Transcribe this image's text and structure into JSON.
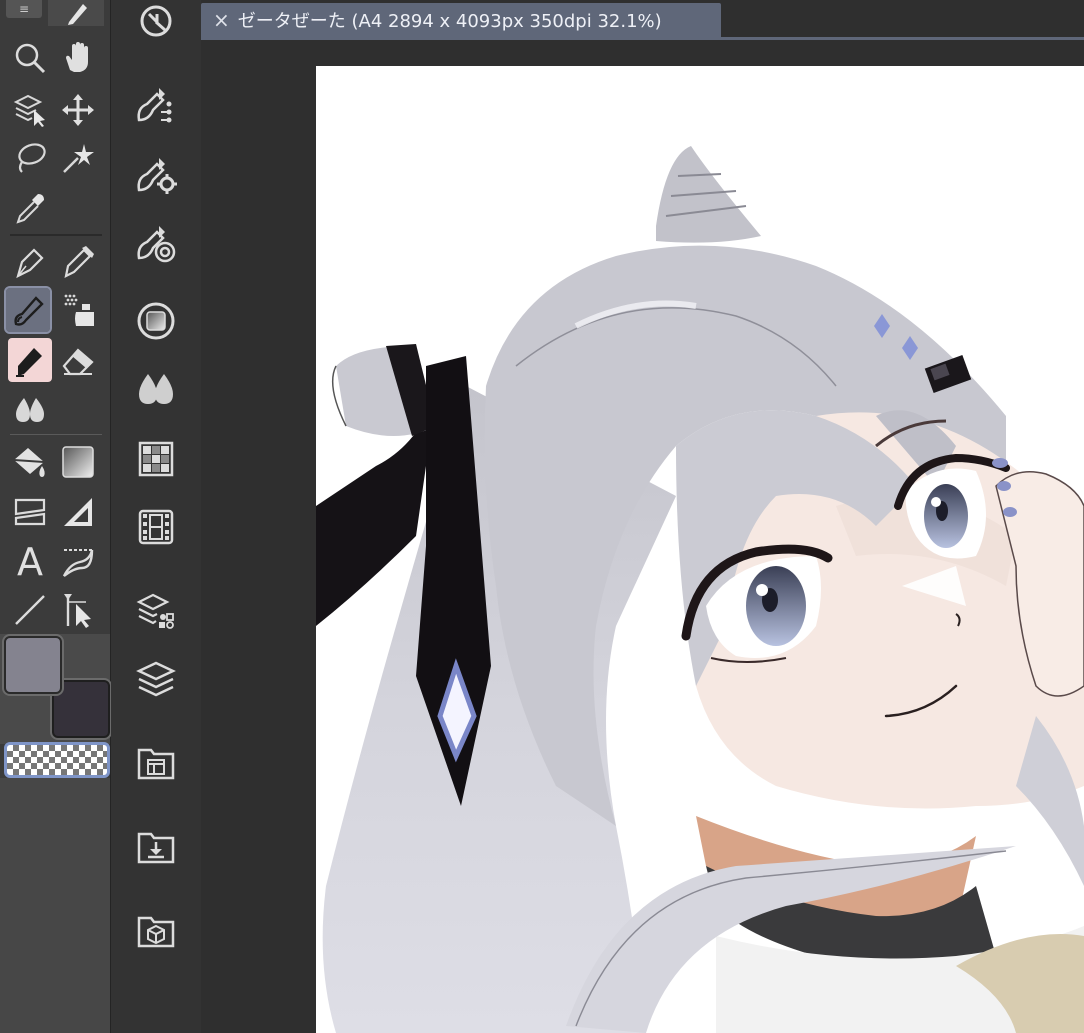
{
  "document_tab": {
    "title": "ゼータぜーた (A4 2894 x 4093px 350dpi 32.1%)",
    "close_icon": "×"
  },
  "tool_palette": {
    "menu_icon": "≡",
    "tools": [
      {
        "name": "zoom",
        "icon": "magnifier-icon"
      },
      {
        "name": "hand",
        "icon": "hand-icon"
      },
      {
        "name": "object-select",
        "icon": "layer-select-icon"
      },
      {
        "name": "move",
        "icon": "move-arrows-icon"
      },
      {
        "name": "lasso",
        "icon": "lasso-icon"
      },
      {
        "name": "auto-select",
        "icon": "magic-wand-icon"
      },
      {
        "name": "eyedropper",
        "icon": "eyedropper-icon"
      },
      {
        "name": "pen",
        "icon": "pen-nib-icon"
      },
      {
        "name": "pencil",
        "icon": "pencil-icon"
      },
      {
        "name": "brush",
        "icon": "brush-icon",
        "active": true
      },
      {
        "name": "airbrush",
        "icon": "airbrush-icon"
      },
      {
        "name": "decoration",
        "icon": "marker-icon"
      },
      {
        "name": "eraser",
        "icon": "eraser-icon"
      },
      {
        "name": "blend",
        "icon": "blend-drops-icon"
      },
      {
        "name": "fill",
        "icon": "bucket-icon"
      },
      {
        "name": "gradient",
        "icon": "gradient-icon"
      },
      {
        "name": "frame",
        "icon": "frame-border-icon"
      },
      {
        "name": "ruler",
        "icon": "ruler-icon"
      },
      {
        "name": "text",
        "icon": "text-icon",
        "label": "A"
      },
      {
        "name": "balloon",
        "icon": "balloon-icon"
      },
      {
        "name": "figure",
        "icon": "line-icon"
      },
      {
        "name": "operation",
        "icon": "correct-line-icon"
      }
    ],
    "colors": {
      "main": "#84838f",
      "sub": "#35313a",
      "accent": "#7f95c8"
    }
  },
  "command_bar": {
    "commands": [
      {
        "name": "undo-history",
        "icon": "history-icon"
      },
      {
        "name": "material",
        "icon": "material-list-icon"
      },
      {
        "name": "sub-tool-settings",
        "icon": "tool-gear-icon"
      },
      {
        "name": "tool-property",
        "icon": "tool-target-icon"
      },
      {
        "name": "color-circle",
        "icon": "color-circle-icon"
      },
      {
        "name": "color-mix",
        "icon": "drops-icon"
      },
      {
        "name": "color-set",
        "icon": "grid-swatches-icon"
      },
      {
        "name": "timeline",
        "icon": "film-icon"
      },
      {
        "name": "layer-property",
        "icon": "layer-property-icon"
      },
      {
        "name": "layers",
        "icon": "layers-icon"
      },
      {
        "name": "canvas-folder",
        "icon": "folder-window-icon"
      },
      {
        "name": "import",
        "icon": "folder-download-icon"
      },
      {
        "name": "3d-material",
        "icon": "folder-cube-icon"
      }
    ]
  }
}
